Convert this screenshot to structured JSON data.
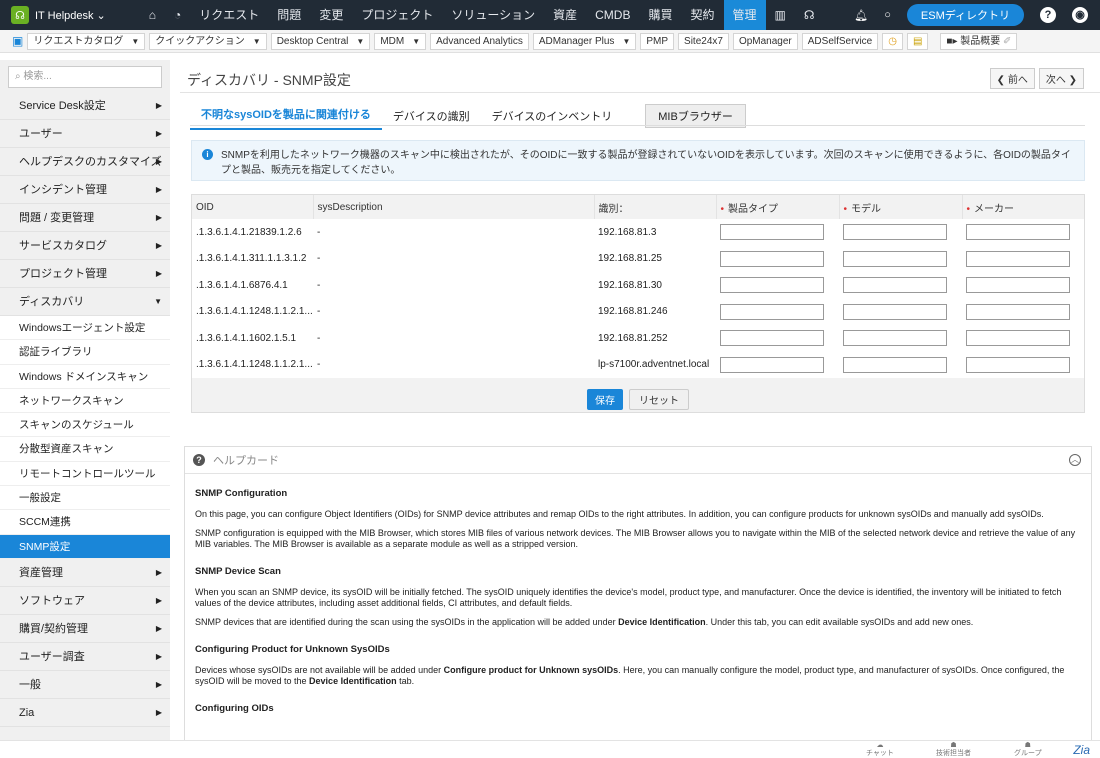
{
  "topnav": {
    "app": "IT Helpdesk",
    "items": [
      "リクエスト",
      "問題",
      "変更",
      "プロジェクト",
      "ソリューション",
      "資産",
      "CMDB",
      "購買",
      "契約",
      "管理"
    ],
    "active": "管理",
    "esm": "ESMディレクトリ"
  },
  "toolbar": {
    "items": [
      "リクエストカタログ",
      "クイックアクション",
      "Desktop Central",
      "MDM",
      "Advanced Analytics",
      "ADManager Plus",
      "PMP",
      "Site24x7",
      "OpManager",
      "ADSelfService"
    ],
    "product_overview": "製品概要"
  },
  "sidebar": {
    "search_placeholder": "検索...",
    "items": [
      "Service Desk設定",
      "ユーザー",
      "ヘルプデスクのカスタマイズ",
      "インシデント管理",
      "問題 / 変更管理",
      "サービスカタログ",
      "プロジェクト管理",
      "ディスカバリ"
    ],
    "sub_items": [
      "Windowsエージェント設定",
      "認証ライブラリ",
      "Windows ドメインスキャン",
      "ネットワークスキャン",
      "スキャンのスケジュール",
      "分散型資産スキャン",
      "リモートコントロールツール",
      "一般設定",
      "SCCM連携",
      "SNMP設定"
    ],
    "items_after": [
      "資産管理",
      "ソフトウェア",
      "購買/契約管理",
      "ユーザー調査",
      "一般",
      "Zia"
    ]
  },
  "page": {
    "title": "ディスカバリ - SNMP設定",
    "prev": "前へ",
    "next": "次へ",
    "tabs": [
      "不明なsysOIDを製品に関連付ける",
      "デバイスの識別",
      "デバイスのインベントリ"
    ],
    "mib_button": "MIBブラウザー",
    "info": "SNMPを利用したネットワーク機器のスキャン中に検出されたが、そのOIDに一致する製品が登録されていないOIDを表示しています。次回のスキャンに使用できるように、各OIDの製品タイプと製品、販売元を指定してください。",
    "columns": [
      "OID",
      "sysDescription",
      "識別：",
      "製品タイプ",
      "モデル",
      "メーカー"
    ],
    "rows": [
      {
        "oid": ".1.3.6.1.4.1.21839.1.2.6",
        "desc": "-",
        "id": "192.168.81.3"
      },
      {
        "oid": ".1.3.6.1.4.1.311.1.1.3.1.2",
        "desc": "-",
        "id": "192.168.81.25"
      },
      {
        "oid": ".1.3.6.1.4.1.6876.4.1",
        "desc": "-",
        "id": "192.168.81.30"
      },
      {
        "oid": ".1.3.6.1.4.1.1248.1.1.2.1...",
        "desc": "-",
        "id": "192.168.81.246"
      },
      {
        "oid": ".1.3.6.1.4.1.1602.1.5.1",
        "desc": "-",
        "id": "192.168.81.252"
      },
      {
        "oid": ".1.3.6.1.4.1.1248.1.1.2.1...",
        "desc": "-",
        "id": "lp-s7100r.adventnet.local"
      }
    ],
    "save": "保存",
    "reset": "リセット"
  },
  "help": {
    "title": "ヘルプカード",
    "h1": "SNMP Configuration",
    "p1": "On this page, you can configure Object Identifiers (OIDs) for SNMP device attributes and remap OIDs to the right attributes. In addition, you can configure products for unknown sysOIDs and manually add sysOIDs.",
    "p2": "SNMP configuration is equipped with the MIB Browser, which stores MIB files of various network devices. The MIB Browser allows you to navigate within the MIB of the selected network device and retrieve the value of any MIB variables. The MIB Browser is available as a separate module as well as a stripped version.",
    "h2": "SNMP Device Scan",
    "p3": "When you scan an SNMP device, its sysOID will be initially fetched. The sysOID uniquely identifies the device's model, product type, and manufacturer. Once the device is identified, the inventory will be initiated to fetch values of the device attributes, including asset additional fields, CI attributes, and default fields.",
    "p4a": "SNMP devices that are identified during the scan using the sysOIDs in the application will be added under ",
    "p4b": "Device Identification",
    "p4c": ". Under this tab, you can edit available sysOIDs and add new ones.",
    "h3": "Configuring Product for Unknown SysOIDs",
    "p5a": "Devices whose sysOIDs are not available will be added under ",
    "p5b": "Configure product for Unknown sysOIDs",
    "p5c": ". Here, you can manually configure the model, product type, and manufacturer of sysOIDs. Once configured, the sysOID will be moved to the ",
    "p5d": "Device Identification",
    "p5e": " tab.",
    "h4": "Configuring OIDs"
  },
  "bottom": {
    "chat": "チャット",
    "technicians": "技術担当者",
    "groups": "グループ",
    "zia": "Zia"
  }
}
